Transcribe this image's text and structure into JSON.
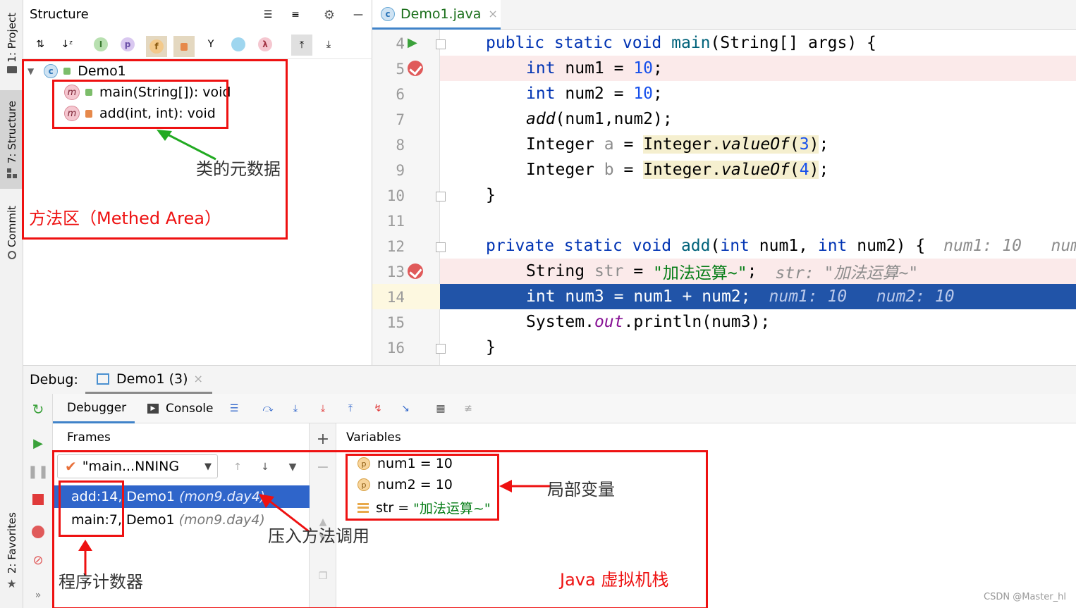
{
  "left_strip": {
    "tabs": [
      {
        "label": "1: Project"
      },
      {
        "label": "7: Structure"
      },
      {
        "label": "Commit"
      },
      {
        "label": "2: Favorites"
      }
    ]
  },
  "structure": {
    "title": "Structure",
    "tree": {
      "root": "Demo1",
      "children": [
        {
          "label": "main(String[]): void"
        },
        {
          "label": "add(int, int): void"
        }
      ]
    },
    "annotations": {
      "metadata": "类的元数据",
      "method_area": "方法区（Methed Area）"
    }
  },
  "editor": {
    "tab_label": "Demo1.java",
    "lines": [
      {
        "n": "4"
      },
      {
        "n": "5"
      },
      {
        "n": "6"
      },
      {
        "n": "7"
      },
      {
        "n": "8"
      },
      {
        "n": "9"
      },
      {
        "n": "10"
      },
      {
        "n": "11"
      },
      {
        "n": "12"
      },
      {
        "n": "13"
      },
      {
        "n": "14"
      },
      {
        "n": "15"
      },
      {
        "n": "16"
      }
    ],
    "code": {
      "l4_kw": "public static void ",
      "l4_name": "main",
      "l4_rest": "(String[] args) {",
      "l5_kw": "int",
      "l5_rest": " num1 = ",
      "l5_num": "10",
      "l6_kw": "int",
      "l6_rest": " num2 = ",
      "l6_num": "10",
      "l7_call": "add",
      "l7_rest": "(num1,num2);",
      "l8_type": "Integer ",
      "l8_var": "a",
      "l8_eq": " = ",
      "l8_cls": "Integer.",
      "l8_m": "valueOf",
      "l8_open": "(",
      "l8_num": "3",
      "l8_close": ")",
      "l8_end": ";",
      "l9_type": "Integer ",
      "l9_var": "b",
      "l9_eq": " = ",
      "l9_cls": "Integer.",
      "l9_m": "valueOf",
      "l9_open": "(",
      "l9_num": "4",
      "l9_close": ")",
      "l9_end": ";",
      "l10": "}",
      "l12_kw1": "private static void ",
      "l12_name": "add",
      "l12_p1": "(",
      "l12_kw2": "int",
      "l12_p2": " num1, ",
      "l12_kw3": "int",
      "l12_p3": " num2) {",
      "l12_inlay": "num1: 10   num",
      "l13_type": "String ",
      "l13_var": "str",
      "l13_eq": " = ",
      "l13_str": "\"加法运算~\"",
      "l13_end": ";",
      "l13_inlay": "str: \"加法运算~\"",
      "l14_kw": "int",
      "l14_rest": " num3 = num1 + num2;",
      "l14_inlay": "num1: 10   num2: 10",
      "l15_a": "System.",
      "l15_out": "out",
      "l15_b": ".println(num3);",
      "l16": "}"
    }
  },
  "debug": {
    "label": "Debug:",
    "session_tab": "Demo1 (3)",
    "tabs": {
      "debugger": "Debugger",
      "console": "Console"
    },
    "frames": {
      "title": "Frames",
      "thread": "\"main...NNING",
      "rows": [
        {
          "method": "add:14, Demo1",
          "pkg": "(mon9.day4)",
          "selected": true
        },
        {
          "method": "main:7, Demo1",
          "pkg": "(mon9.day4)",
          "selected": false
        }
      ]
    },
    "variables": {
      "title": "Variables",
      "rows": [
        {
          "name": "num1",
          "eq": " = ",
          "value": "10"
        },
        {
          "name": "num2",
          "eq": " = ",
          "value": "10"
        },
        {
          "name": "str",
          "eq": " = ",
          "value": "\"加法运算~\""
        }
      ]
    },
    "annotations": {
      "push_call": "压入方法调用",
      "pc": "程序计数器",
      "locals": "局部变量",
      "jvm_stack": "Java 虚拟机栈"
    }
  },
  "watermark": "CSDN @Master_hl",
  "colors": {
    "annotation_red": "#ee1111",
    "selection_blue": "#2f65ca",
    "current_line": "#2154a8",
    "breakpoint_line": "#fbeaea",
    "keyword": "#0033b3",
    "number": "#1750eb",
    "string": "#067d17"
  }
}
